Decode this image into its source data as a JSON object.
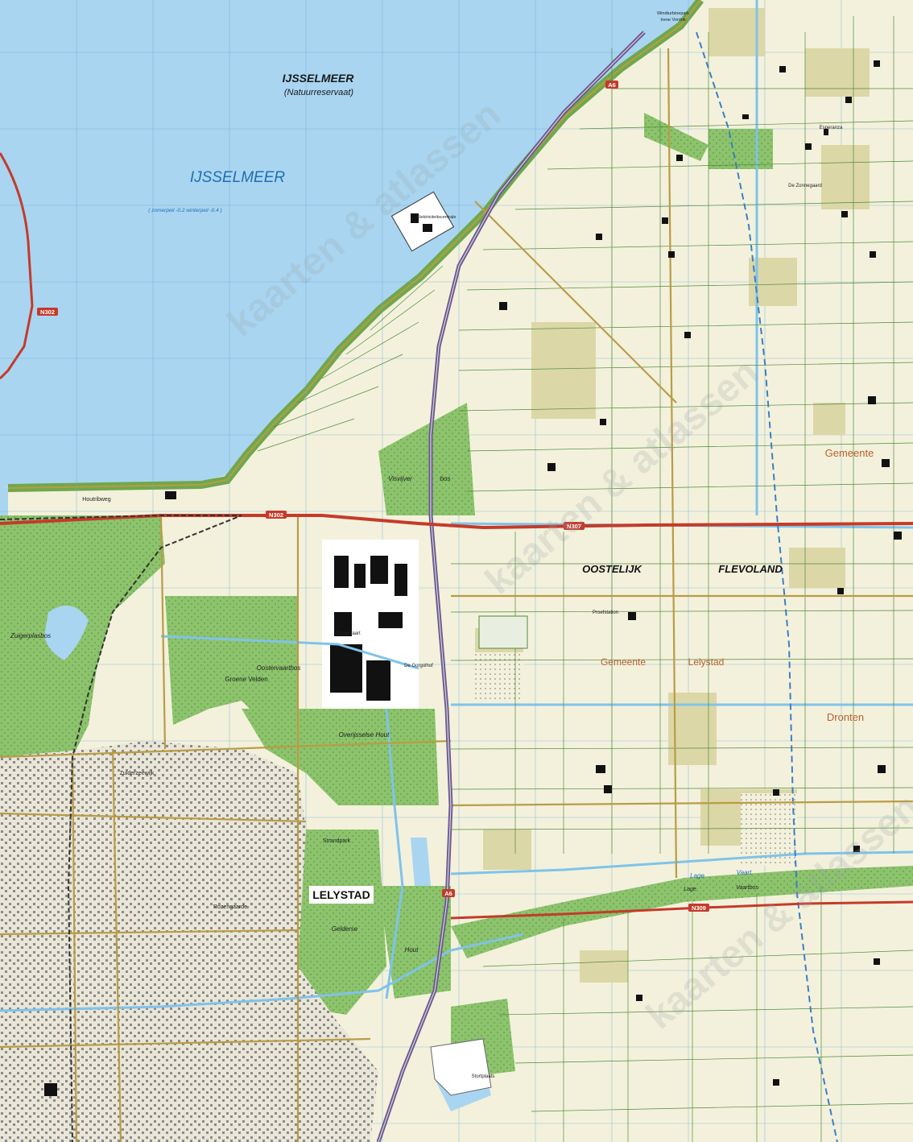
{
  "map": {
    "water": {
      "lake_name": "IJSSELMEER",
      "reserve_name": "IJSSELMEER",
      "reserve_sub": "(Natuurreservaat)",
      "level_note": "( zomerpeil -0.2 winterpeil -0.4 )"
    },
    "regions": {
      "oostelijk": "OOSTELIJK",
      "flevoland": "FLEVOLAND",
      "city": "LELYSTAD"
    },
    "municipalities": {
      "gemeente_right": "Gemeente",
      "gemeente_center": "Gemeente",
      "lelystad": "Lelystad",
      "dronten": "Dronten"
    },
    "roads": {
      "n302": "N302",
      "n307": "N307",
      "n309": "N309",
      "a6_top": "A6",
      "a6_mid": "A6",
      "a6_south": "A6"
    },
    "places": {
      "houtribweg": "Houtribweg",
      "visvijver": "Visvijver",
      "bos": "bos",
      "zuigerplasbos": "Zuigerplasbos",
      "groene_velden": "Groene Velden",
      "oostervaartbos": "Oostervaartbos",
      "overijsselse_hout": "Overijsselse Hout",
      "gelderse": "Gelderse",
      "hout": "Hout",
      "lage_vaart": "Lage",
      "vaart": "Vaart",
      "lage_vaartbos": "Lage",
      "vaartbos": "Vaartbos",
      "windturbinepark": "Windturbinepark",
      "irene_vorrink": "Irene Vorrink",
      "elektriciteitscentrale": "Elektriciteitscentrale",
      "stortplaats": "Stortplaats",
      "strandpark": "Strandpark",
      "rozengaarde": "Rozengaarde",
      "zuiderzeewijk": "Zuiderzeewijk",
      "oostervaart": "Oostervaart",
      "de_gorgol": "De Gorgolhof",
      "proefstation": "Proefstation",
      "de_zonnegaard": "De Zonnegaard",
      "esperanza": "Esperanza",
      "gemeente_note": "Gemeente"
    },
    "colors": {
      "water": "#a9d5f1",
      "land": "#f3f1dc",
      "forest": "#8cc36c",
      "field": "#dcd7a6",
      "road_main": "#c53a2a",
      "highway": "#6b5b8c",
      "canal": "#7fc3ea",
      "municipality_label": "#b8622e",
      "water_label": "#1f6fb2"
    },
    "watermark": "kaarten & atlassen"
  }
}
